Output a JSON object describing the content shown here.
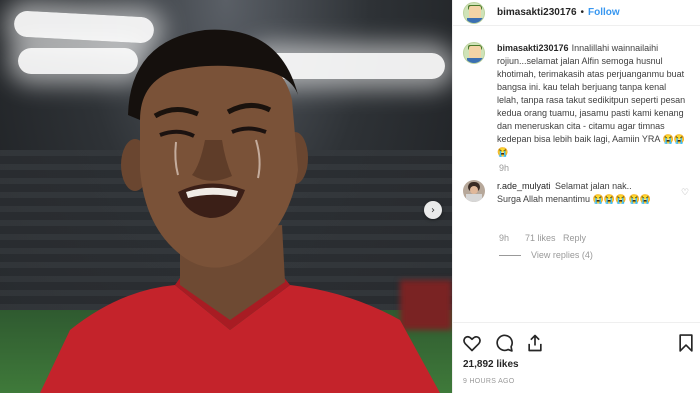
{
  "post": {
    "username": "bimasakti230176",
    "follow_label": "Follow",
    "separator": "•",
    "caption": "Innalillahi wainnailaihi rojiun...selamat jalan Alfin semoga husnul khotimah, terimakasih atas perjuanganmu buat bangsa ini. kau telah berjuang tanpa kenal lelah, tanpa rasa takut sedikitpun seperti pesan kedua orang tuamu, jasamu pasti kami kenang dan meneruskan cita - citamu agar timnas kedepan bisa lebih baik lagi, Aamiin YRA 😭😭😭",
    "caption_time": "9h",
    "next_glyph": "›"
  },
  "comment": {
    "username": "r.ade_mulyati",
    "text": "Selamat jalan nak.. Surga Allah menantimu 😭😭😭 😭😭",
    "time": "9h",
    "likes": "71 likes",
    "reply_label": "Reply",
    "view_replies": "View replies (4)",
    "like_glyph": "♡"
  },
  "footer": {
    "likes": "21,892 likes",
    "timestamp": "9 HOURS AGO"
  },
  "icons": [
    "heart-icon",
    "comment-icon",
    "share-icon",
    "bookmark-icon",
    "chevron-right-icon"
  ],
  "colors": {
    "accent": "#3897f0",
    "text": "#262626",
    "muted": "#999999",
    "jersey": "#c4232b"
  }
}
